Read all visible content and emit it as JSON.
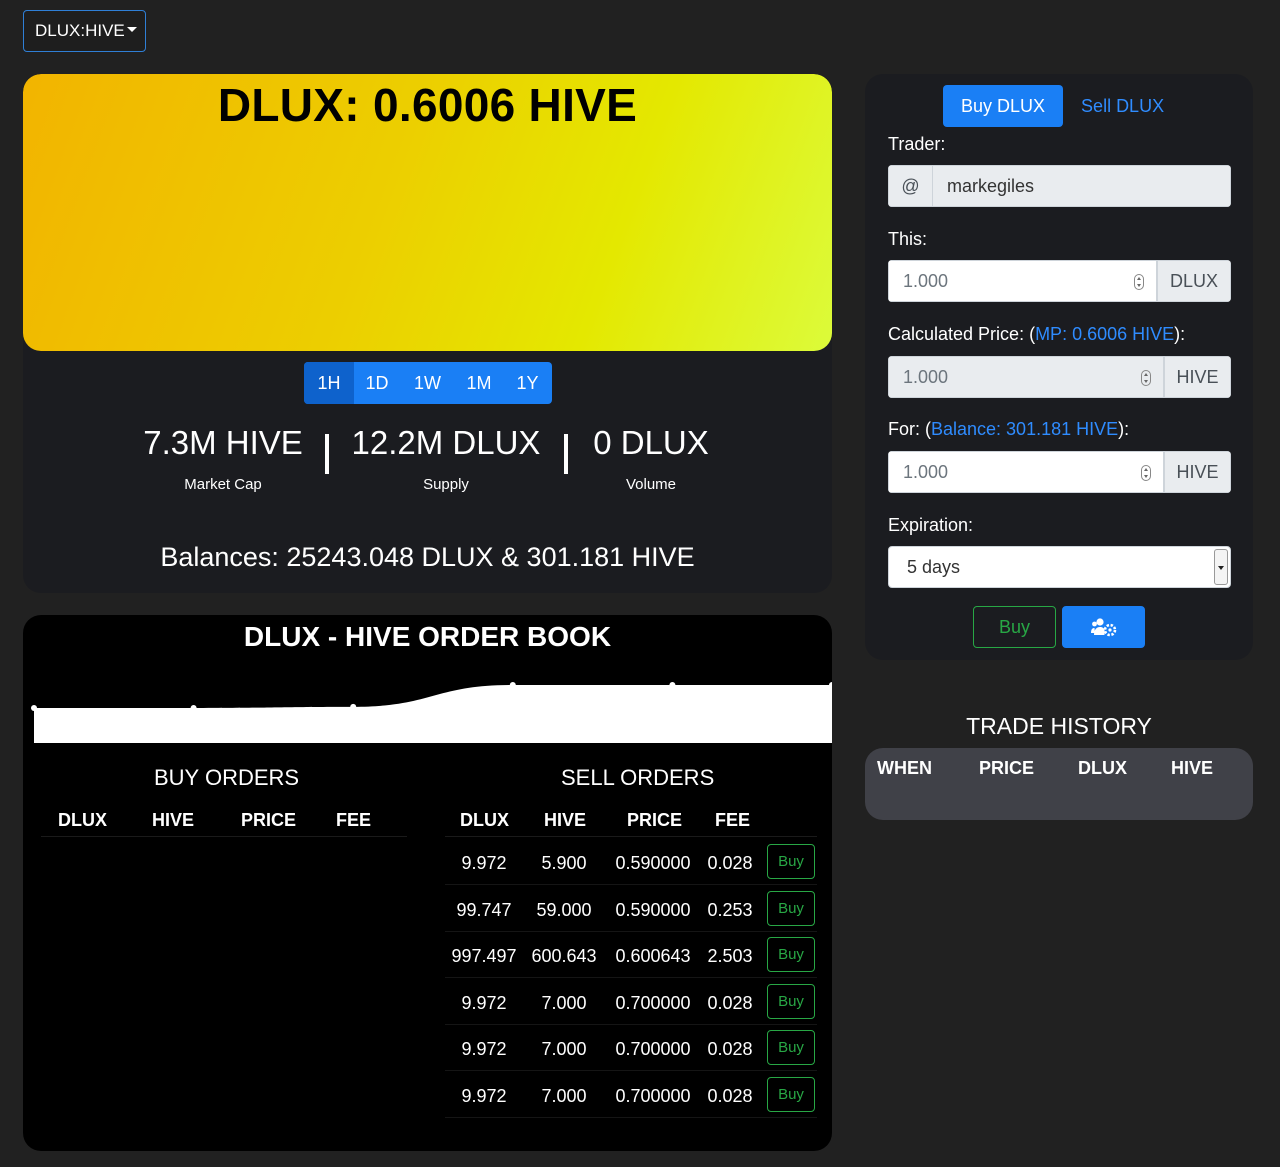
{
  "pair_selector": {
    "label": "DLUX:HIVE"
  },
  "price_card": {
    "title": "DLUX: 0.6006 HIVE",
    "ranges": [
      "1H",
      "1D",
      "1W",
      "1M",
      "1Y"
    ],
    "active_range": "1H",
    "stats": [
      {
        "value": "7.3M HIVE",
        "label": "Market Cap"
      },
      {
        "value": "12.2M DLUX",
        "label": "Supply"
      },
      {
        "value": "0 DLUX",
        "label": "Volume"
      }
    ],
    "balances": "Balances: 25243.048 DLUX & 301.181 HIVE"
  },
  "trade_form": {
    "tabs": {
      "buy": "Buy DLUX",
      "sell": "Sell DLUX",
      "active": "buy"
    },
    "trader_label": "Trader:",
    "trader_prefix": "@",
    "trader_value": "markegiles",
    "this_label": "This:",
    "this_value": "1.000",
    "this_unit": "DLUX",
    "calc_label_pre": "Calculated Price: (",
    "calc_label_link": "MP: 0.6006 HIVE",
    "calc_label_post": "):",
    "calc_value": "1.000",
    "calc_unit": "HIVE",
    "for_label_pre": "For: (",
    "for_label_link": "Balance: 301.181 HIVE",
    "for_label_post": "):",
    "for_value": "1.000",
    "for_unit": "HIVE",
    "expiration_label": "Expiration:",
    "expiration_value": "5 days",
    "buy_button": "Buy",
    "settings_icon": "users-gear-icon"
  },
  "trade_history": {
    "title": "TRADE HISTORY",
    "columns": [
      "WHEN",
      "PRICE",
      "DLUX",
      "HIVE"
    ]
  },
  "order_book": {
    "title": "DLUX - HIVE ORDER BOOK",
    "buy_orders": {
      "title": "BUY ORDERS",
      "columns": [
        "DLUX",
        "HIVE",
        "PRICE",
        "FEE"
      ],
      "rows": []
    },
    "sell_orders": {
      "title": "SELL ORDERS",
      "columns": [
        "DLUX",
        "HIVE",
        "PRICE",
        "FEE"
      ],
      "action_label": "Buy",
      "rows": [
        [
          "9.972",
          "5.900",
          "0.590000",
          "0.028"
        ],
        [
          "99.747",
          "59.000",
          "0.590000",
          "0.253"
        ],
        [
          "997.497",
          "600.643",
          "0.600643",
          "2.503"
        ],
        [
          "9.972",
          "7.000",
          "0.700000",
          "0.028"
        ],
        [
          "9.972",
          "7.000",
          "0.700000",
          "0.028"
        ],
        [
          "9.972",
          "7.000",
          "0.700000",
          "0.028"
        ]
      ]
    },
    "depth_chart": {
      "type": "area",
      "x": [
        0,
        1,
        2,
        3,
        4,
        5
      ],
      "values": [
        0.6,
        0.6,
        0.62,
        1.0,
        1.0,
        1.0
      ],
      "fill": "#ffffff"
    }
  },
  "colors": {
    "background": "#212121",
    "card": "#1b1c20",
    "accent_blue": "#1a7ff5",
    "success_green": "#28a745",
    "gradient_start": "#f2b400",
    "gradient_end": "#dcfb3a"
  }
}
